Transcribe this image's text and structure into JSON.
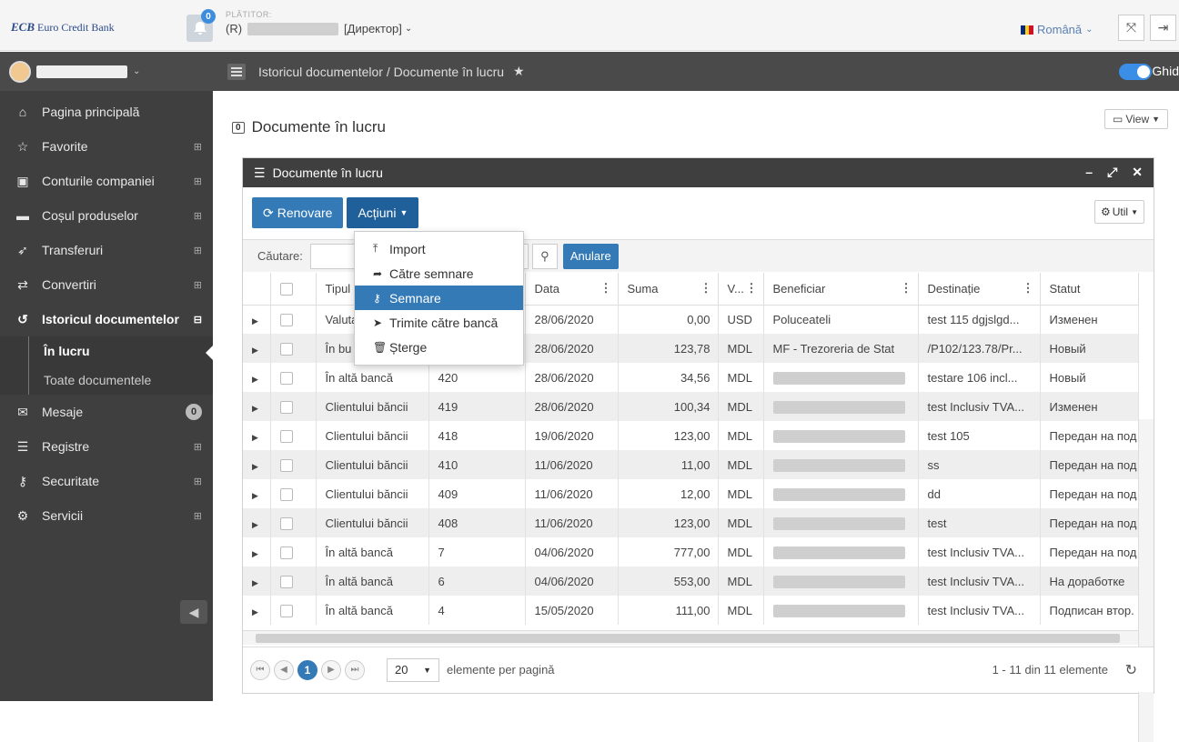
{
  "topbar": {
    "logo_text": "Euro Credit Bank",
    "logo_mark": "ECB",
    "notifications_count": "0",
    "payer_label": "PLĂTITOR:",
    "payer_prefix": "(R)",
    "payer_role": "[Директор]",
    "language": "Română"
  },
  "sidebar": {
    "items": [
      {
        "label": "Pagina principală",
        "icon": "home-icon",
        "glyph": "⌂"
      },
      {
        "label": "Favorite",
        "icon": "star-icon",
        "glyph": "☆"
      },
      {
        "label": "Conturile companiei",
        "icon": "account-icon",
        "glyph": "▣"
      },
      {
        "label": "Coșul produselor",
        "icon": "briefcase-icon",
        "glyph": "▬"
      },
      {
        "label": "Transferuri",
        "icon": "send-icon",
        "glyph": "➶"
      },
      {
        "label": "Convertiri",
        "icon": "exchange-icon",
        "glyph": "⇄"
      },
      {
        "label": "Istoricul documentelor",
        "icon": "history-icon",
        "glyph": "↺"
      }
    ],
    "sub_items": [
      {
        "label": "În lucru"
      },
      {
        "label": "Toate documentele"
      }
    ],
    "items2": [
      {
        "label": "Mesaje",
        "icon": "message-icon",
        "glyph": "✉",
        "badge": "0"
      },
      {
        "label": "Registre",
        "icon": "list-icon",
        "glyph": "☰"
      },
      {
        "label": "Securitate",
        "icon": "key-icon",
        "glyph": "⚷"
      },
      {
        "label": "Servicii",
        "icon": "cogs-icon",
        "glyph": "⚙"
      }
    ]
  },
  "breadcrumb": {
    "text": "Istoricul documentelor / Documente în lucru",
    "toggle_label": "Ghid"
  },
  "page": {
    "title": "Documente în lucru",
    "view_label": "View"
  },
  "panel": {
    "title": "Documente în lucru",
    "refresh_label": "Renovare",
    "actions_label": "Acțiuni",
    "util_label": "Util",
    "search_label": "Căutare:",
    "cancel_label": "Anulare"
  },
  "actions_menu": [
    {
      "label": "Import",
      "icon": "upload-icon",
      "glyph": "⤒"
    },
    {
      "label": "Către semnare",
      "icon": "share-icon",
      "glyph": "➦"
    },
    {
      "label": "Semnare",
      "icon": "key-icon",
      "glyph": "⚷"
    },
    {
      "label": "Trimite către bancă",
      "icon": "send-icon",
      "glyph": "➤"
    },
    {
      "label": "Șterge",
      "icon": "trash-icon",
      "glyph": "🗑"
    }
  ],
  "table": {
    "columns": [
      "",
      "",
      "Tipul",
      "",
      "Data",
      "Suma",
      "V...",
      "Beneficiar",
      "Destinație",
      "Statut"
    ],
    "rows": [
      {
        "type": "Valuta",
        "nr": "",
        "date": "28/06/2020",
        "sum": "0,00",
        "cur": "USD",
        "benef": "Poluceateli",
        "dest": "test 115 dgjslgd...",
        "status": "Изменен"
      },
      {
        "type": "În bu",
        "nr": "",
        "date": "28/06/2020",
        "sum": "123,78",
        "cur": "MDL",
        "benef": "MF - Trezoreria de Stat",
        "dest": "/P102/123.78/Pr...",
        "status": "Новый"
      },
      {
        "type": "În altă bancă",
        "nr": "420",
        "date": "28/06/2020",
        "sum": "34,56",
        "cur": "MDL",
        "benef": "",
        "dest": "testare 106 incl...",
        "status": "Новый"
      },
      {
        "type": "Clientului băncii",
        "nr": "419",
        "date": "28/06/2020",
        "sum": "100,34",
        "cur": "MDL",
        "benef": "",
        "dest": "test Inclusiv TVA...",
        "status": "Изменен"
      },
      {
        "type": "Clientului băncii",
        "nr": "418",
        "date": "19/06/2020",
        "sum": "123,00",
        "cur": "MDL",
        "benef": "",
        "dest": "test 105",
        "status": "Передан на под"
      },
      {
        "type": "Clientului băncii",
        "nr": "410",
        "date": "11/06/2020",
        "sum": "11,00",
        "cur": "MDL",
        "benef": "",
        "dest": "ss",
        "status": "Передан на под"
      },
      {
        "type": "Clientului băncii",
        "nr": "409",
        "date": "11/06/2020",
        "sum": "12,00",
        "cur": "MDL",
        "benef": "",
        "dest": "dd",
        "status": "Передан на под"
      },
      {
        "type": "Clientului băncii",
        "nr": "408",
        "date": "11/06/2020",
        "sum": "123,00",
        "cur": "MDL",
        "benef": "",
        "dest": "test",
        "status": "Передан на под"
      },
      {
        "type": "În altă bancă",
        "nr": "7",
        "date": "04/06/2020",
        "sum": "777,00",
        "cur": "MDL",
        "benef": "",
        "dest": "test Inclusiv TVA...",
        "status": "Передан на под"
      },
      {
        "type": "În altă bancă",
        "nr": "6",
        "date": "04/06/2020",
        "sum": "553,00",
        "cur": "MDL",
        "benef": "",
        "dest": "test Inclusiv TVA...",
        "status": "На доработке"
      },
      {
        "type": "În altă bancă",
        "nr": "4",
        "date": "15/05/2020",
        "sum": "111,00",
        "cur": "MDL",
        "benef": "",
        "dest": "test Inclusiv TVA...",
        "status": "Подписан втор."
      }
    ]
  },
  "pager": {
    "current_page": "1",
    "page_size": "20",
    "page_size_label": "elemente per pagină",
    "info": "1 - 11 din 11 elemente"
  }
}
